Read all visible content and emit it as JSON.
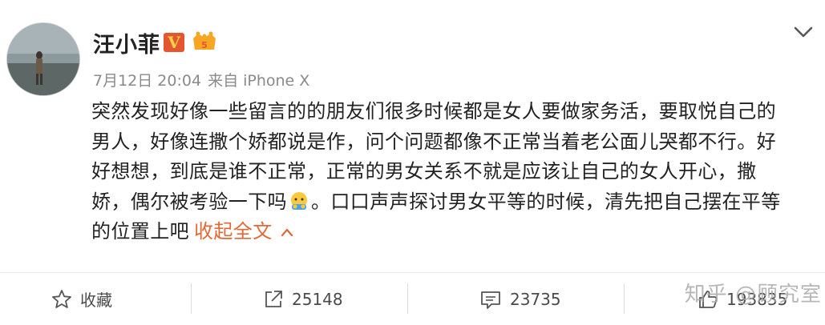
{
  "post": {
    "username": "汪小菲",
    "verified_badge": "V",
    "member_badge_icon": "vip-crown-icon",
    "timestamp": "7月12日 20:04",
    "source": "来自 iPhone X",
    "content_lines": [
      "突然发现好像一些留言的的朋友们很多时候都是女人要做家务活，要取悦自己的",
      "男人，好像连撒个娇都说是作，问个问题都像不正常当着老公面儿哭都不行。好",
      "好想想，到底是谁不正常，正常的男女关系不就是应该让自己的女人开心，撒",
      "娇，偶尔被考验一下吗",
      "。口口声声探讨男女平等的时候，清先把自己摆在平等",
      "的位置上吧"
    ],
    "collapse_link": "收起全文"
  },
  "actions": {
    "favorite_label": "收藏",
    "repost_count": "25148",
    "comment_count": "23735",
    "like_count": "193835"
  },
  "watermark": "知乎 @顾究室",
  "colors": {
    "link": "#e06a36",
    "badge_bg": "#e4572e",
    "badge_fg": "#ffd24a",
    "meta_text": "#8a8a8a"
  }
}
